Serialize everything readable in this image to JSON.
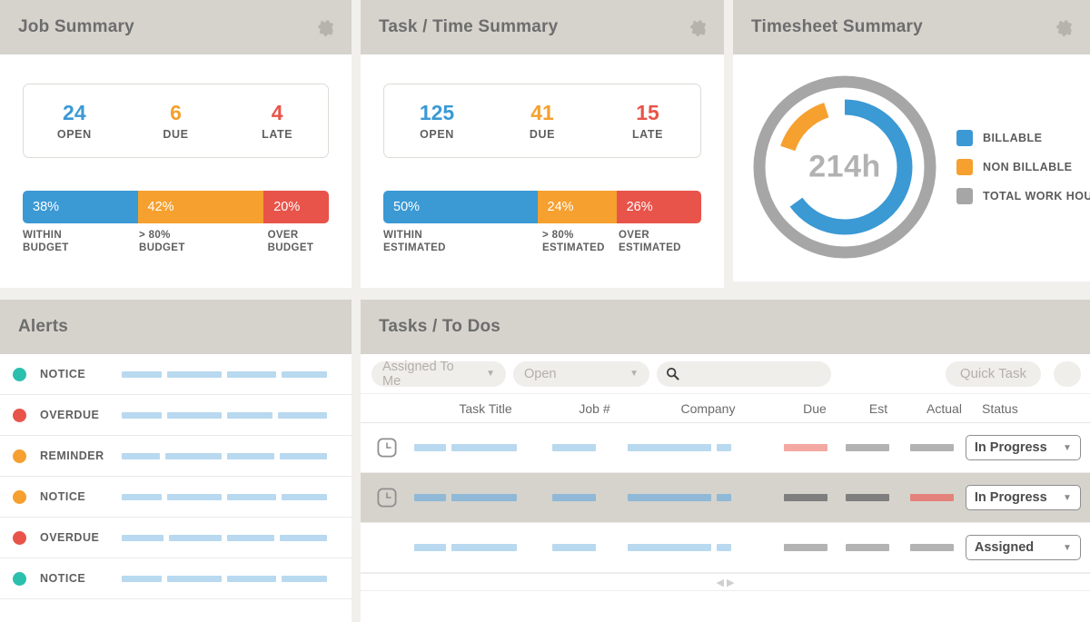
{
  "colors": {
    "blue": "#3b99d4",
    "orange": "#f5a02f",
    "red": "#e8544a",
    "gray": "#a6a6a6",
    "teal": "#2bbfae",
    "panel_head": "#d6d3cd",
    "page_bg": "#f2f0ec",
    "placeholder_blue": "#b8d9ef",
    "placeholder_pink": "#f3a9a1",
    "placeholder_gray": "#b3b3b3"
  },
  "job_summary": {
    "title": "Job Summary",
    "gear_icon": "gear-icon",
    "stats": [
      {
        "value": "24",
        "label": "OPEN",
        "color": "#3b99d4"
      },
      {
        "value": "6",
        "label": "DUE",
        "color": "#f5a02f"
      },
      {
        "value": "4",
        "label": "LATE",
        "color": "#e8544a"
      }
    ],
    "segments": [
      {
        "pct": "38%",
        "value": 38,
        "label": "WITHIN\nBUDGET",
        "color": "#3b99d4"
      },
      {
        "pct": "42%",
        "value": 42,
        "label": "> 80%\nBUDGET",
        "color": "#f5a02f"
      },
      {
        "pct": "20%",
        "value": 20,
        "label": "OVER\nBUDGET",
        "color": "#e8544a"
      }
    ]
  },
  "task_time_summary": {
    "title": "Task / Time Summary",
    "gear_icon": "gear-icon",
    "stats": [
      {
        "value": "125",
        "label": "OPEN",
        "color": "#3b99d4"
      },
      {
        "value": "41",
        "label": "DUE",
        "color": "#f5a02f"
      },
      {
        "value": "15",
        "label": "LATE",
        "color": "#e8544a"
      }
    ],
    "segments": [
      {
        "pct": "50%",
        "value": 50,
        "label": "WITHIN\nESTIMATED",
        "color": "#3b99d4"
      },
      {
        "pct": "24%",
        "value": 24,
        "label": "> 80%\nESTIMATED",
        "color": "#f5a02f"
      },
      {
        "pct": "26%",
        "value": 26,
        "label": "OVER\nESTIMATED",
        "color": "#e8544a"
      }
    ]
  },
  "timesheet_summary": {
    "title": "Timesheet Summary",
    "gear_icon": "gear-icon",
    "center_value": "214h",
    "legend": [
      {
        "label": "BILLABLE",
        "color": "#3b99d4"
      },
      {
        "label": "NON BILLABLE",
        "color": "#f5a02f"
      },
      {
        "label": "TOTAL WORK HOURS",
        "color": "#a6a6a6"
      }
    ]
  },
  "chart_data": {
    "type": "pie",
    "title": "Timesheet Summary",
    "center_label": "214h",
    "legend_position": "right",
    "rings": [
      {
        "name": "inner",
        "slices": [
          {
            "name": "BILLABLE",
            "value": 65,
            "color": "#3b99d4",
            "start_deg": 0,
            "end_deg": 234
          },
          {
            "name": "gap",
            "value": 15,
            "color": "#ffffff",
            "start_deg": 234,
            "end_deg": 288
          },
          {
            "name": "NON BILLABLE",
            "value": 15,
            "color": "#f5a02f",
            "start_deg": 288,
            "end_deg": 342
          },
          {
            "name": "gap",
            "value": 5,
            "color": "#ffffff",
            "start_deg": 342,
            "end_deg": 360
          }
        ]
      },
      {
        "name": "outer",
        "slices": [
          {
            "name": "TOTAL WORK HOURS",
            "value": 100,
            "color": "#a6a6a6",
            "start_deg": 0,
            "end_deg": 360
          }
        ]
      }
    ]
  },
  "alerts": {
    "title": "Alerts",
    "rows": [
      {
        "type": "NOTICE",
        "dot_color": "#2bbfae",
        "bars": [
          44,
          60,
          54,
          50
        ]
      },
      {
        "type": "OVERDUE",
        "dot_color": "#e8544a",
        "bars": [
          44,
          60,
          50,
          54
        ]
      },
      {
        "type": "REMINDER",
        "dot_color": "#f5a02f",
        "bars": [
          42,
          62,
          52,
          52
        ]
      },
      {
        "type": "NOTICE",
        "dot_color": "#f5a02f",
        "bars": [
          44,
          60,
          54,
          50
        ]
      },
      {
        "type": "OVERDUE",
        "dot_color": "#e8544a",
        "bars": [
          46,
          58,
          52,
          52
        ]
      },
      {
        "type": "NOTICE",
        "dot_color": "#2bbfae",
        "bars": [
          44,
          60,
          54,
          50
        ]
      }
    ]
  },
  "tasks": {
    "title": "Tasks / To Dos",
    "toolbar": {
      "assigned_filter": "Assigned To Me",
      "status_filter": "Open",
      "search_placeholder": "",
      "search_value": "",
      "search_icon": "search-icon",
      "quick_task_label": "Quick Task",
      "caret_icon": "chevron-down-icon"
    },
    "columns": [
      "",
      "Task Title",
      "Job #",
      "Company",
      "Due",
      "Est",
      "Actual",
      "Status"
    ],
    "rows": [
      {
        "has_clock_icon": true,
        "highlight": false,
        "title_bars": [
          52,
          108
        ],
        "job_bars": [
          52
        ],
        "company_bars": [
          96,
          18
        ],
        "due_bar_color": "#f3a9a1",
        "est_bar_color": "#b3b3b3",
        "actual_bar_color": "#b3b3b3",
        "status": "In Progress"
      },
      {
        "has_clock_icon": true,
        "highlight": true,
        "title_bars": [
          52,
          108
        ],
        "job_bars": [
          52
        ],
        "company_bars": [
          96,
          18
        ],
        "due_bar_color": "#7f7f7f",
        "est_bar_color": "#7f7f7f",
        "actual_bar_color": "#e2827a",
        "status": "In Progress"
      },
      {
        "has_clock_icon": false,
        "highlight": false,
        "title_bars": [
          52,
          108
        ],
        "job_bars": [
          52
        ],
        "company_bars": [
          96,
          18
        ],
        "due_bar_color": "#b3b3b3",
        "est_bar_color": "#b3b3b3",
        "actual_bar_color": "#b3b3b3",
        "status": "Assigned"
      }
    ],
    "scroll_left_icon": "chevron-left-icon",
    "scroll_right_icon": "chevron-right-icon"
  }
}
